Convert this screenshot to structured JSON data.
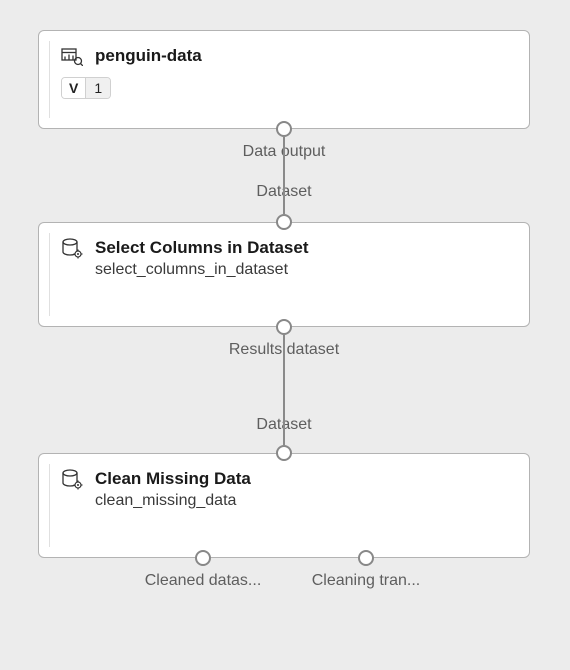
{
  "nodes": {
    "node1": {
      "title": "penguin-data",
      "version_prefix": "V",
      "version_value": "1",
      "output_label": "Data output"
    },
    "node2": {
      "title": "Select Columns in Dataset",
      "subtitle": "select_columns_in_dataset",
      "input_label": "Dataset",
      "output_label": "Results dataset"
    },
    "node3": {
      "title": "Clean Missing Data",
      "subtitle": "clean_missing_data",
      "input_label": "Dataset",
      "output1_label": "Cleaned datas...",
      "output2_label": "Cleaning tran..."
    }
  }
}
